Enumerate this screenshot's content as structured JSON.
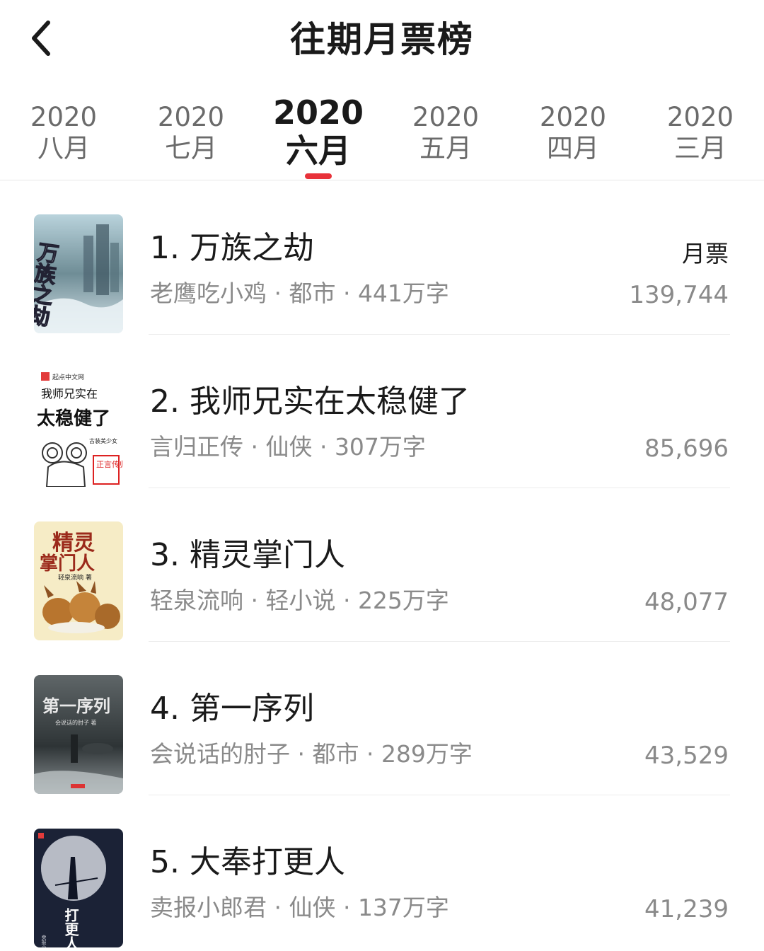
{
  "header": {
    "title": "往期月票榜"
  },
  "tabs": [
    {
      "year": "2020",
      "month": "八月",
      "active": false
    },
    {
      "year": "2020",
      "month": "七月",
      "active": false
    },
    {
      "year": "2020",
      "month": "六月",
      "active": true
    },
    {
      "year": "2020",
      "month": "五月",
      "active": false
    },
    {
      "year": "2020",
      "month": "四月",
      "active": false
    },
    {
      "year": "2020",
      "month": "三月",
      "active": false
    }
  ],
  "list": {
    "votes_label": "月票",
    "books": [
      {
        "title": "1. 万族之劫",
        "author": "老鹰吃小鸡",
        "genre": "都市",
        "words": "441万字",
        "meta": "老鹰吃小鸡 · 都市 · 441万字",
        "votes": "139,744",
        "cover_text": "万族之劫"
      },
      {
        "title": "2. 我师兄实在太稳健了",
        "author": "言归正传",
        "genre": "仙侠",
        "words": "307万字",
        "meta": "言归正传 · 仙侠 · 307万字",
        "votes": "85,696",
        "cover_text": "我师兄实在",
        "cover_text2": "太稳健了",
        "cover_brand": "起点中文网",
        "cover_tag": "古装美少女",
        "cover_seal": "正言传归"
      },
      {
        "title": "3. 精灵掌门人",
        "author": "轻泉流响",
        "genre": "轻小说",
        "words": "225万字",
        "meta": "轻泉流响 · 轻小说 · 225万字",
        "votes": "48,077",
        "cover_text": "精灵",
        "cover_text2": "掌门人",
        "cover_sub": "轻泉流响 著"
      },
      {
        "title": "4. 第一序列",
        "author": "会说话的肘子",
        "genre": "都市",
        "words": "289万字",
        "meta": "会说话的肘子 · 都市 · 289万字",
        "votes": "43,529",
        "cover_text": "第一序列",
        "cover_sub": "会说话的肘子 著"
      },
      {
        "title": "5. 大奉打更人",
        "author": "卖报小郎君",
        "genre": "仙侠",
        "words": "137万字",
        "meta": "卖报小郎君 · 仙侠 · 137万字",
        "votes": "41,239",
        "cover_text": "打更人",
        "cover_sub": "卖报小郎君 著"
      }
    ]
  },
  "colors": {
    "accent": "#e8323a",
    "text_primary": "#1a1a1a",
    "text_secondary": "#8a8a8a"
  }
}
